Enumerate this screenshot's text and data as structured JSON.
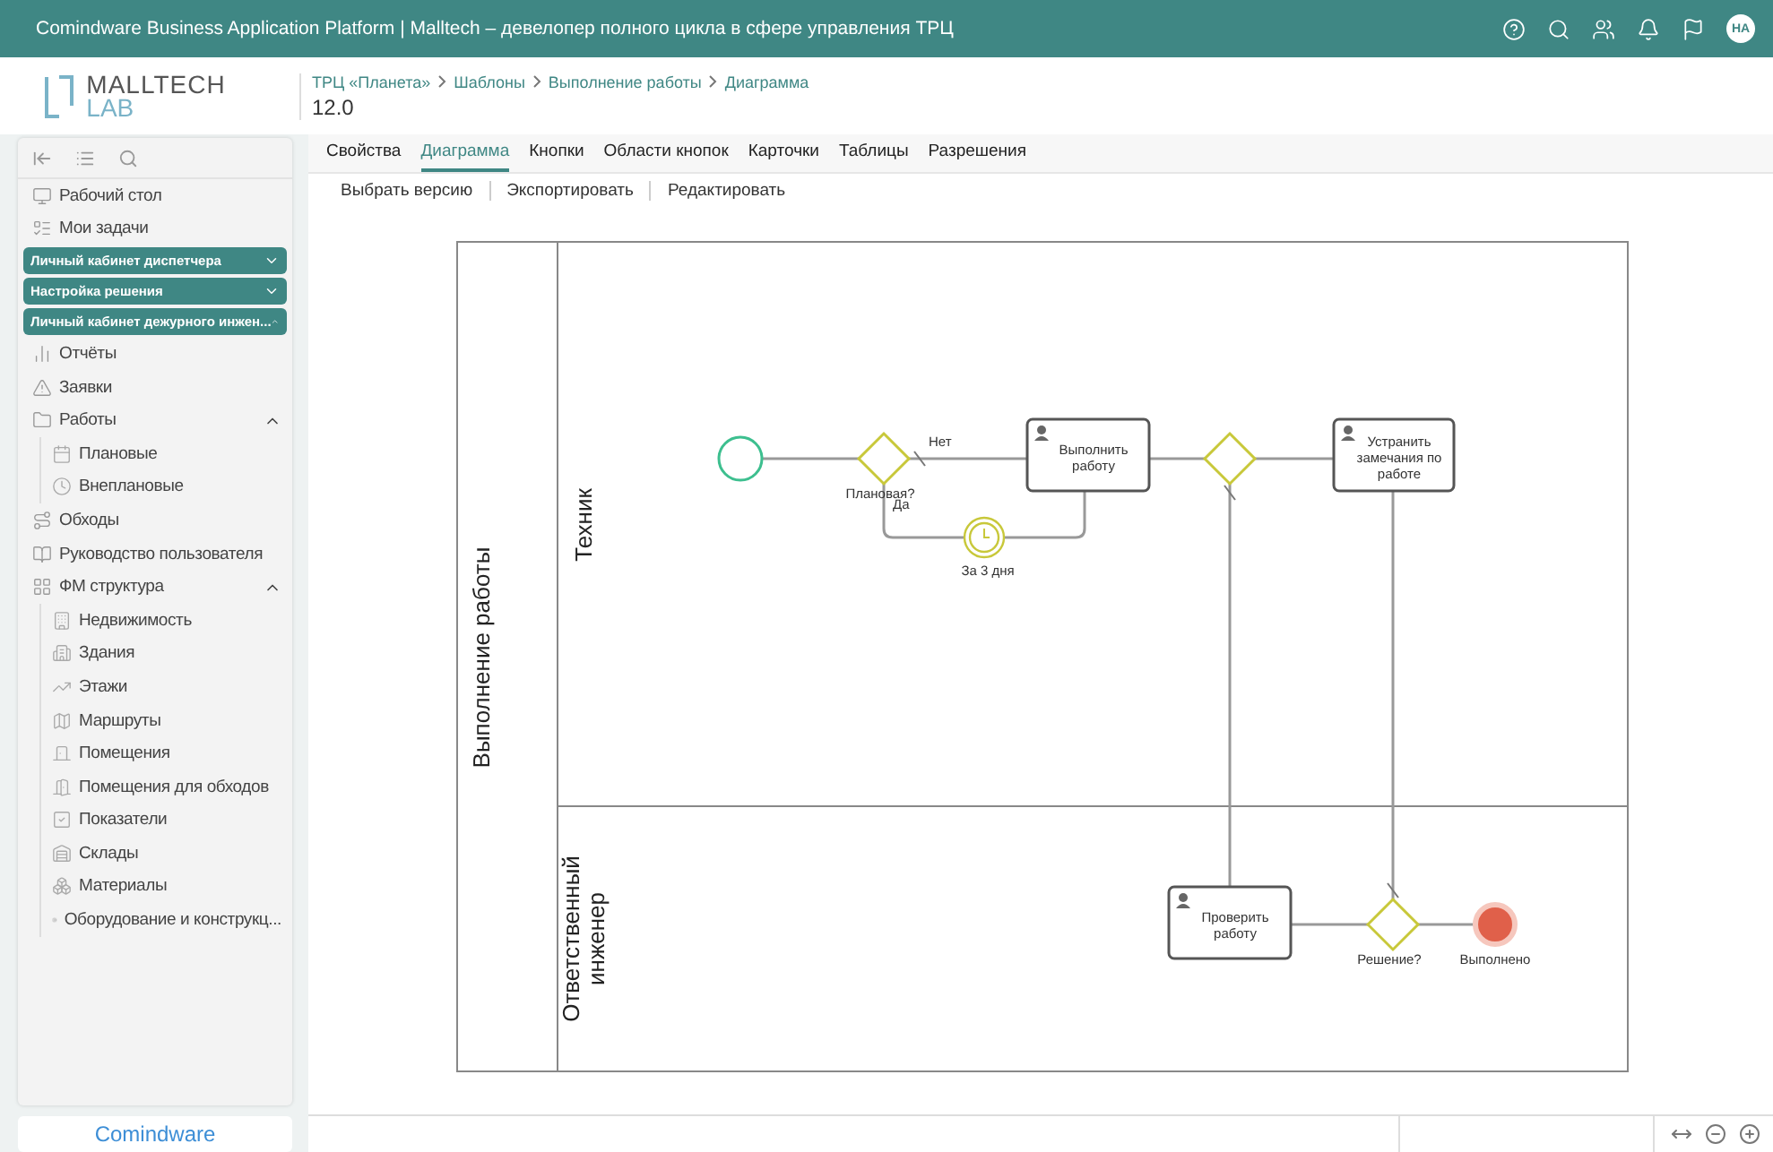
{
  "top_bar": {
    "title": "Comindware Business Application Platform | Malltech – девелопер полного цикла в сфере управления ТРЦ",
    "avatar": "НА"
  },
  "logo": {
    "name": "MALLTECH",
    "sub": "LAB"
  },
  "breadcrumbs": [
    "ТРЦ «Планета»",
    "Шаблоны",
    "Выполнение работы",
    "Диаграмма"
  ],
  "version": "12.0",
  "sidebar": {
    "items": [
      {
        "kind": "item",
        "label": "Рабочий стол"
      },
      {
        "kind": "item",
        "label": "Мои задачи"
      },
      {
        "kind": "section",
        "label": "Личный кабинет диспетчера",
        "expanded": false
      },
      {
        "kind": "section",
        "label": "Настройка решения",
        "expanded": false
      },
      {
        "kind": "section",
        "label": "Личный кабинет дежурного инжен...",
        "expanded": true
      },
      {
        "kind": "item",
        "label": "Отчёты"
      },
      {
        "kind": "item",
        "label": "Заявки"
      },
      {
        "kind": "item",
        "label": "Работы",
        "expanded": true,
        "children": [
          {
            "label": "Плановые"
          },
          {
            "label": "Внеплановые"
          }
        ]
      },
      {
        "kind": "item",
        "label": "Обходы"
      },
      {
        "kind": "item",
        "label": "Руководство пользователя"
      },
      {
        "kind": "item",
        "label": "ФМ структура",
        "expanded": true,
        "children": [
          {
            "label": "Недвижимость"
          },
          {
            "label": "Здания"
          },
          {
            "label": "Этажи"
          },
          {
            "label": "Маршруты"
          },
          {
            "label": "Помещения"
          },
          {
            "label": "Помещения для обходов"
          },
          {
            "label": "Показатели"
          },
          {
            "label": "Склады"
          },
          {
            "label": "Материалы"
          },
          {
            "label": "Оборудование и конструкц..."
          }
        ]
      }
    ],
    "footer": "Comindware"
  },
  "tabs": [
    {
      "label": "Свойства",
      "selected": false
    },
    {
      "label": "Диаграмма",
      "selected": true
    },
    {
      "label": "Кнопки",
      "selected": false
    },
    {
      "label": "Области кнопок",
      "selected": false
    },
    {
      "label": "Карточки",
      "selected": false
    },
    {
      "label": "Таблицы",
      "selected": false
    },
    {
      "label": "Разрешения",
      "selected": false
    }
  ],
  "actions": [
    "Выбрать версию",
    "Экспортировать",
    "Редактировать"
  ],
  "diagram": {
    "pool": "Выполнение работы",
    "lanes": [
      {
        "label": "Техник"
      },
      {
        "label": "Ответственный инженер"
      }
    ],
    "nodes": [
      {
        "kind": "start"
      },
      {
        "kind": "gateway",
        "label": "Плановая?"
      },
      {
        "kind": "task",
        "label": "Выполнить работу"
      },
      {
        "kind": "timer",
        "label": "За 3 дня"
      },
      {
        "kind": "gateway"
      },
      {
        "kind": "task",
        "label": "Устранить замечания по работе"
      },
      {
        "kind": "task",
        "label": "Проверить работу"
      },
      {
        "kind": "gateway",
        "label": "Решение?"
      },
      {
        "kind": "end",
        "label": "Выполнено"
      }
    ],
    "flow_labels": [
      "Нет",
      "Да"
    ]
  }
}
